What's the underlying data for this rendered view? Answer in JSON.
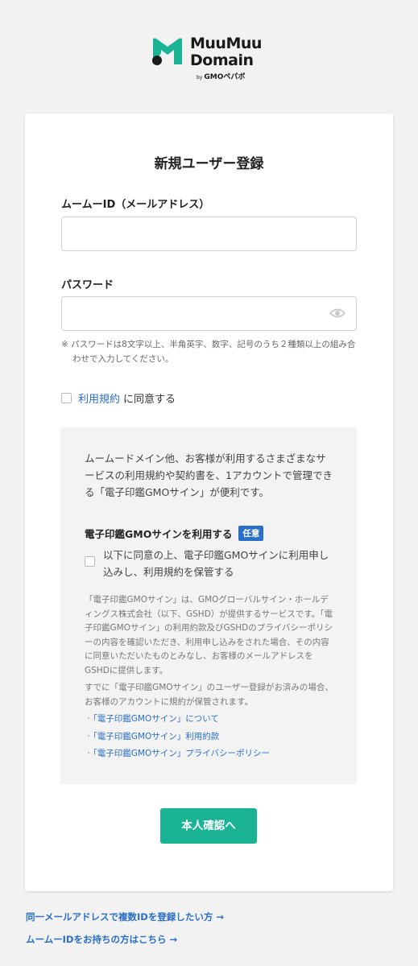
{
  "logo": {
    "line1": "MuuMuu",
    "line2": "Domain",
    "by": "by",
    "byline": "GMOペパボ",
    "colors": {
      "teal": "#1ab394",
      "dark": "#1a1a1a"
    }
  },
  "form": {
    "title": "新規ユーザー登録",
    "id_label": "ムームーID（メールアドレス）",
    "id_value": "",
    "password_label": "パスワード",
    "password_value": "",
    "password_toggle_icon": "eye-icon",
    "password_note": "※ パスワードは8文字以上、半角英字、数字、記号のうち２種類以上の組み合わせで入力してください。",
    "terms_link": "利用規約",
    "terms_suffix": "に同意する"
  },
  "gmo_sign": {
    "intro": "ムームードメイン他、お客様が利用するさまざまなサービスの利用規約や契約書を、1アカウントで管理できる「電子印鑑GMOサイン」が便利です。",
    "heading": "電子印鑑GMOサインを利用する",
    "badge": "任意",
    "checkbox_label": "以下に同意の上、電子印鑑GMOサインに利用申し込みし、利用規約を保管する",
    "para1": "「電子印鑑GMOサイン」は、GMOグローバルサイン・ホールディングス株式会社（以下、GSHD）が提供するサービスです。「電子印鑑GMOサイン」の利用約款及びGSHDのプライバシーポリシーの内容を確認いただき、利用申し込みをされた場合、その内容に同意いただいたものとみなし、お客様のメールアドレスをGSHDに提供します。",
    "para2": "すでに「電子印鑑GMOサイン」のユーザー登録がお済みの場合、お客様のアカウントに規約が保管されます。",
    "links": [
      "「電子印鑑GMOサイン」について",
      "「電子印鑑GMOサイン」利用約款",
      "「電子印鑑GMOサイン」プライバシーポリシー"
    ],
    "colors": {
      "link": "#2a6fc9",
      "badge": "#2a6fc9"
    }
  },
  "submit_label": "本人確認へ",
  "footer": {
    "link1": "同一メールアドレスで複数IDを登録したい方 →",
    "link2": "ムームーIDをお持ちの方はこちら →"
  },
  "colors": {
    "primary": "#1ab394",
    "background": "#f2f2f2"
  }
}
